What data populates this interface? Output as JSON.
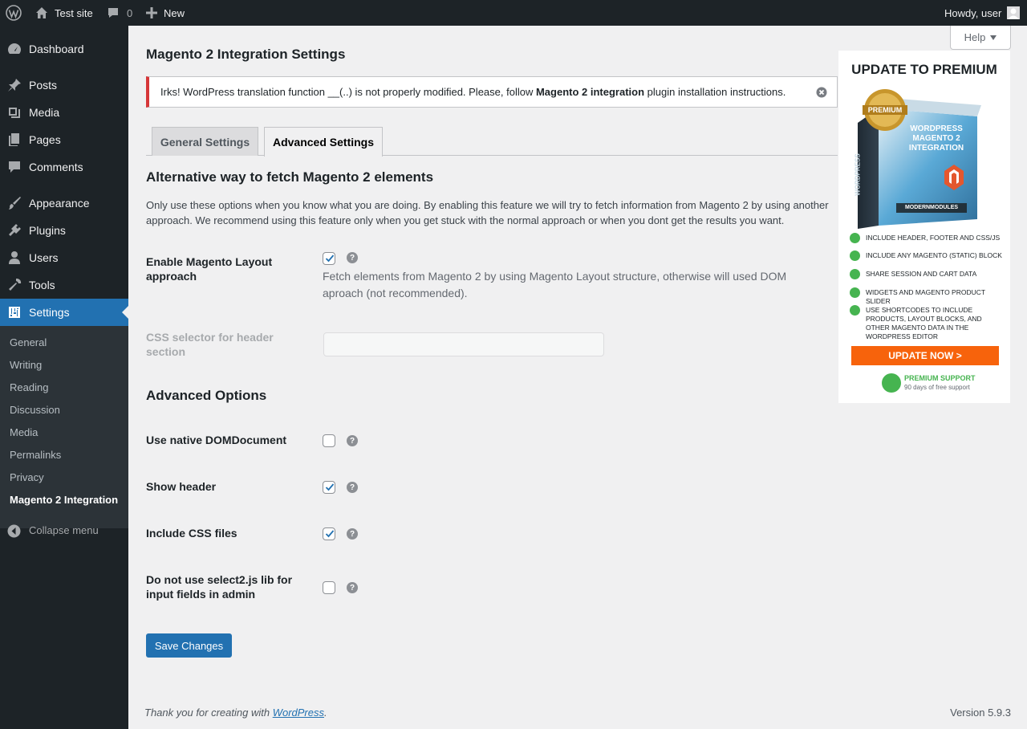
{
  "adminbar": {
    "site_name": "Test site",
    "comments_count": "0",
    "new_label": "New",
    "howdy": "Howdy, user"
  },
  "sidebar": {
    "items": [
      {
        "label": "Dashboard",
        "icon": "dashboard-icon"
      },
      {
        "label": "Posts",
        "icon": "pin-icon"
      },
      {
        "label": "Media",
        "icon": "media-icon"
      },
      {
        "label": "Pages",
        "icon": "pages-icon"
      },
      {
        "label": "Comments",
        "icon": "comment-icon"
      },
      {
        "label": "Appearance",
        "icon": "brush-icon"
      },
      {
        "label": "Plugins",
        "icon": "plugin-icon"
      },
      {
        "label": "Users",
        "icon": "users-icon"
      },
      {
        "label": "Tools",
        "icon": "wrench-icon"
      },
      {
        "label": "Settings",
        "icon": "settings-icon"
      }
    ],
    "submenu": [
      "General",
      "Writing",
      "Reading",
      "Discussion",
      "Media",
      "Permalinks",
      "Privacy",
      "Magento 2 Integration"
    ],
    "collapse": "Collapse menu"
  },
  "help": "Help",
  "page": {
    "title": "Magento 2 Integration Settings",
    "notice_pre": "Irks! WordPress translation function __(..) is not properly modified. Please, follow ",
    "notice_bold": "Magento 2 integration",
    "notice_post": " plugin installation instructions.",
    "tabs": [
      "General Settings",
      "Advanced Settings"
    ],
    "section1_title": "Alternative way to fetch Magento 2 elements",
    "section1_desc": "Only use these options when you know what you are doing. By enabling this feature we will try to fetch information from Magento 2 by using another approach. We recommend using this feature only when you get stuck with the normal approach or when you dont get the results you want.",
    "layout_label": "Enable Magento Layout approach",
    "layout_checked": true,
    "layout_desc": "Fetch elements from Magento 2 by using Magento Layout structure, otherwise will used DOM aproach (not recommended).",
    "css_selector_label": "CSS selector for header section",
    "css_selector_value": "",
    "section2_title": "Advanced Options",
    "options": [
      {
        "label": "Use native DOMDocument",
        "checked": false
      },
      {
        "label": "Show header",
        "checked": true
      },
      {
        "label": "Include CSS files",
        "checked": true
      },
      {
        "label": "Do not use select2.js lib for input fields in admin",
        "checked": false
      }
    ],
    "save_label": "Save Changes"
  },
  "footer": {
    "thanks_pre": "Thank you for creating with ",
    "thanks_link": "WordPress",
    "thanks_post": ".",
    "version": "Version 5.9.3"
  },
  "ad": {
    "title": "UPDATE TO PREMIUM",
    "box_badge": "PREMIUM",
    "box_title": "WORDPRESS MAGENTO 2 INTEGRATION",
    "box_brand": "MODERNMODULES",
    "box_side": "WORDPRESS",
    "features": [
      "Include header, footer and CSS/JS",
      "Include any Magento (static) block",
      "Share session and cart data",
      "Widgets and Magento product slider",
      "Use shortcodes to include products, layout blocks, and other Magento data in the WordPress editor"
    ],
    "button": "UPDATE NOW >",
    "support_title": "PREMIUM SUPPORT",
    "support_sub": "90 days of free support",
    "accent": "#f7630c",
    "check_color": "#46b450"
  }
}
